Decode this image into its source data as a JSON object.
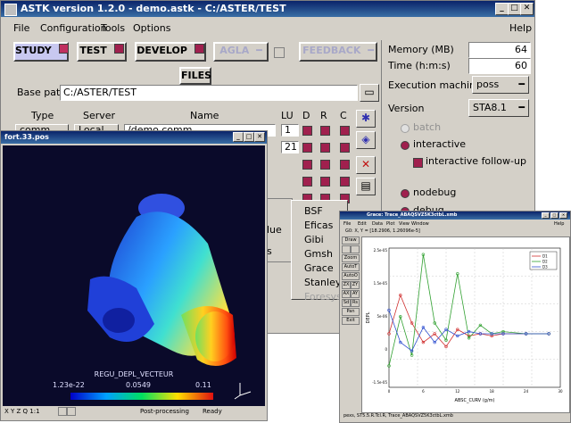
{
  "main_window": {
    "title": "ASTK version 1.2.0 - demo.astk - C:/ASTER/TEST",
    "menu": [
      "File",
      "Configuration",
      "Tools",
      "Options"
    ],
    "help_label": "Help",
    "modes": {
      "study": "STUDY",
      "test": "TEST",
      "develop": "DEVELOP",
      "agla": "AGLA",
      "feedback": "FEEDBACK"
    },
    "files_label": "FILES",
    "base_path_label": "Base path",
    "base_path": "C:/ASTER/TEST",
    "table_headers": {
      "type": "Type",
      "server": "Server",
      "name": "Name",
      "lu": "LU",
      "d": "D",
      "r": "R",
      "c": "C"
    },
    "first_row": {
      "type": "comm",
      "server": "Local",
      "name": "/demo.comm",
      "lu": "1"
    },
    "second_row_lu": "21",
    "right_panel": {
      "memory_label": "Memory (MB)",
      "memory_value": "64",
      "time_label": "Time (h:m:s)",
      "time_value": "60",
      "exec_label": "Execution machine",
      "exec_value": "poss",
      "version_label": "Version",
      "version_value": "STA8.1",
      "batch": "batch",
      "interactive": "interactive",
      "interactive_follow": "interactive follow-up",
      "nodebug": "nodebug",
      "debug": "debug"
    }
  },
  "popup_menu": {
    "partial_left": [
      "...",
      "lue",
      "s"
    ],
    "items": [
      "BSF",
      "Eficas",
      "Gibi",
      "Gmsh",
      "Grace",
      "Stanley",
      "Foresys"
    ]
  },
  "post_window": {
    "title": "fort.33.pos",
    "field_name": "REGU_DEPL_VECTEUR",
    "scale_min": "1.23e-22",
    "scale_mid": "0.0549",
    "scale_max": "0.11",
    "status_left": "X Y Z Q 1:1",
    "status_mid": "Post-processing",
    "status_right": "Ready",
    "colors": {
      "background": "#0a0a2a",
      "low": "#0000c8",
      "high": "#e01010"
    }
  },
  "grace_window": {
    "title": "Grace: Trace_ABAQSVZ5K3ctbL.xmb",
    "menu": [
      "File",
      "Edit",
      "Data",
      "Plot",
      "View",
      "Window"
    ],
    "help_label": "Help",
    "readout": "G0: X, Y = [18.2906, 1.26096e-5]",
    "side_buttons": [
      "Draw",
      "Zoom",
      "AutoT",
      "AutoO",
      "ZX",
      "ZY",
      "AX",
      "AY",
      "Sd",
      "Rs",
      "Pan",
      "Exit"
    ],
    "footer": "pexs, ST5.5.R.Tcl.R, Trace_ABAQSVZ5K3ctbL.xmb",
    "chart_data": {
      "type": "line",
      "xlabel": "ABSC_CURV (g/m)",
      "ylabel": "DEPL",
      "xlim": [
        0,
        30
      ],
      "ylim": [
        -2.5e-05,
        4e-05
      ],
      "y_tick_labels": [
        "2.5e-05",
        "1.5e-05",
        "5e-06",
        "0",
        "-1.5e-05"
      ],
      "grid": true,
      "legend_position": "top-right",
      "series": [
        {
          "name": "D1",
          "color": "#d03030",
          "values": [
            [
              0,
              0.0
            ],
            [
              2,
              1.8e-05
            ],
            [
              4,
              5e-06
            ],
            [
              6,
              -4e-06
            ],
            [
              8,
              0.0
            ],
            [
              10,
              -6e-06
            ],
            [
              12,
              2e-06
            ],
            [
              14,
              -1e-06
            ],
            [
              16,
              0.0
            ],
            [
              18,
              -1e-06
            ],
            [
              20,
              0.0
            ],
            [
              24,
              0.0
            ],
            [
              28,
              0.0
            ]
          ]
        },
        {
          "name": "D2",
          "color": "#30a030",
          "values": [
            [
              0,
              -1.5e-05
            ],
            [
              2,
              8e-06
            ],
            [
              4,
              -1e-05
            ],
            [
              6,
              3.7e-05
            ],
            [
              8,
              5e-06
            ],
            [
              10,
              -3e-06
            ],
            [
              12,
              2.8e-05
            ],
            [
              14,
              -2e-06
            ],
            [
              16,
              4e-06
            ],
            [
              18,
              0.0
            ],
            [
              20,
              1e-06
            ],
            [
              24,
              0.0
            ],
            [
              28,
              0.0
            ]
          ]
        },
        {
          "name": "D3",
          "color": "#3050d0",
          "values": [
            [
              0,
              1.1e-05
            ],
            [
              2,
              -4e-06
            ],
            [
              4,
              -8e-06
            ],
            [
              6,
              3e-06
            ],
            [
              8,
              -4e-06
            ],
            [
              10,
              2e-06
            ],
            [
              12,
              -1e-06
            ],
            [
              14,
              1e-06
            ],
            [
              16,
              0.0
            ],
            [
              18,
              0.0
            ],
            [
              20,
              0.0
            ],
            [
              24,
              0.0
            ],
            [
              28,
              0.0
            ]
          ]
        }
      ]
    }
  }
}
